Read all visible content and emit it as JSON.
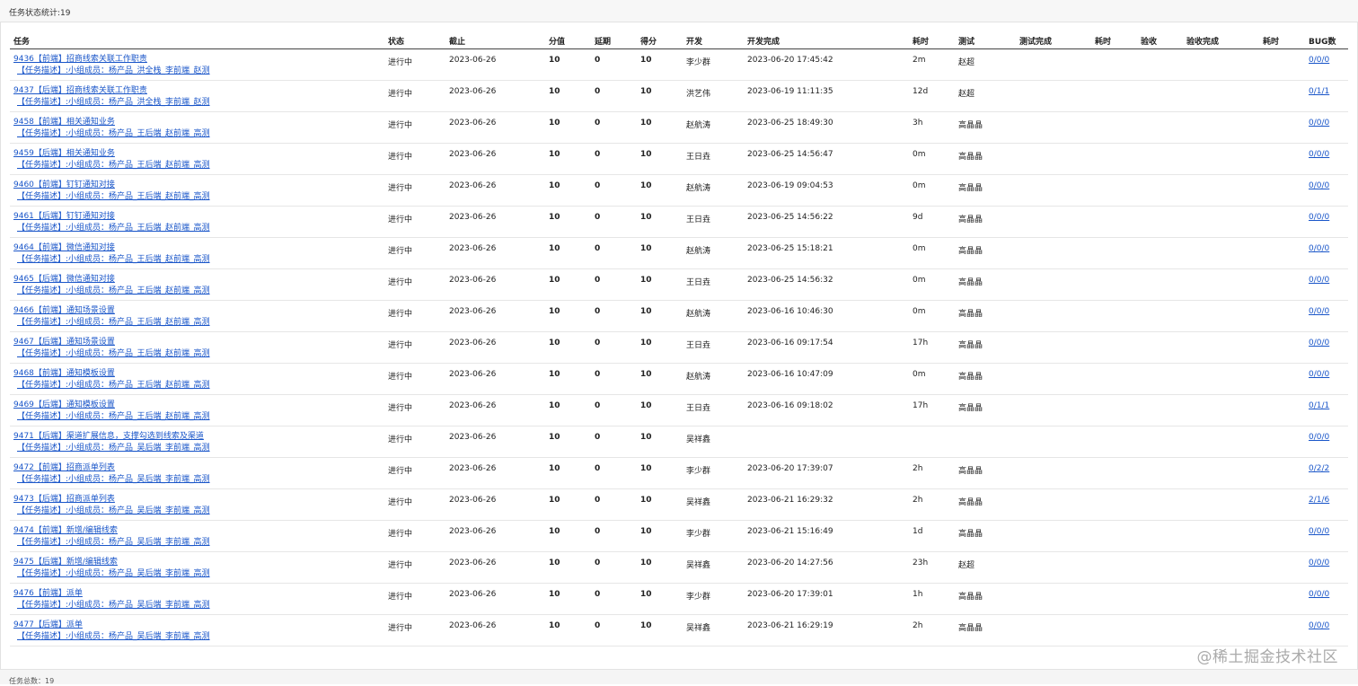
{
  "header": {
    "title": "任务状态统计:19"
  },
  "columns": [
    "任务",
    "状态",
    "截止",
    "分值",
    "延期",
    "得分",
    "开发",
    "开发完成",
    "耗时",
    "测试",
    "测试完成",
    "耗时",
    "验收",
    "验收完成",
    "耗时",
    "BUG数"
  ],
  "rows": [
    {
      "title": "9436【前端】招商线索关联工作职责",
      "desc": "【任务描述】:小组成员：杨产品_洪全栈_李前端_赵测",
      "status": "进行中",
      "deadline": "2023-06-26",
      "points": "10",
      "delay": "0",
      "score": "10",
      "dev": "李少群",
      "dev_done": "2023-06-20 17:45:42",
      "dev_time": "2m",
      "tester": "赵超",
      "test_done": "",
      "test_time": "",
      "acceptor": "",
      "accept_done": "",
      "accept_time": "",
      "bugs": "0/0/0"
    },
    {
      "title": "9437【后端】招商线索关联工作职责",
      "desc": "【任务描述】:小组成员：杨产品_洪全栈_李前端_赵测",
      "status": "进行中",
      "deadline": "2023-06-26",
      "points": "10",
      "delay": "0",
      "score": "10",
      "dev": "洪艺伟",
      "dev_done": "2023-06-19 11:11:35",
      "dev_time": "12d",
      "tester": "赵超",
      "test_done": "",
      "test_time": "",
      "acceptor": "",
      "accept_done": "",
      "accept_time": "",
      "bugs": "0/1/1"
    },
    {
      "title": "9458【前端】相关通知业务",
      "desc": "【任务描述】:小组成员：杨产品_王后端_赵前端_高测",
      "status": "进行中",
      "deadline": "2023-06-26",
      "points": "10",
      "delay": "0",
      "score": "10",
      "dev": "赵航涛",
      "dev_done": "2023-06-25 18:49:30",
      "dev_time": "3h",
      "tester": "高晶晶",
      "test_done": "",
      "test_time": "",
      "acceptor": "",
      "accept_done": "",
      "accept_time": "",
      "bugs": "0/0/0"
    },
    {
      "title": "9459【后端】相关通知业务",
      "desc": "【任务描述】:小组成员：杨产品_王后端_赵前端_高测",
      "status": "进行中",
      "deadline": "2023-06-26",
      "points": "10",
      "delay": "0",
      "score": "10",
      "dev": "王日垚",
      "dev_done": "2023-06-25 14:56:47",
      "dev_time": "0m",
      "tester": "高晶晶",
      "test_done": "",
      "test_time": "",
      "acceptor": "",
      "accept_done": "",
      "accept_time": "",
      "bugs": "0/0/0"
    },
    {
      "title": "9460【前端】钉钉通知对接",
      "desc": "【任务描述】:小组成员：杨产品_王后端_赵前端_高测",
      "status": "进行中",
      "deadline": "2023-06-26",
      "points": "10",
      "delay": "0",
      "score": "10",
      "dev": "赵航涛",
      "dev_done": "2023-06-19 09:04:53",
      "dev_time": "0m",
      "tester": "高晶晶",
      "test_done": "",
      "test_time": "",
      "acceptor": "",
      "accept_done": "",
      "accept_time": "",
      "bugs": "0/0/0"
    },
    {
      "title": "9461【后端】钉钉通知对接",
      "desc": "【任务描述】:小组成员：杨产品_王后端_赵前端_高测",
      "status": "进行中",
      "deadline": "2023-06-26",
      "points": "10",
      "delay": "0",
      "score": "10",
      "dev": "王日垚",
      "dev_done": "2023-06-25 14:56:22",
      "dev_time": "9d",
      "tester": "高晶晶",
      "test_done": "",
      "test_time": "",
      "acceptor": "",
      "accept_done": "",
      "accept_time": "",
      "bugs": "0/0/0"
    },
    {
      "title": "9464【前端】微信通知对接",
      "desc": "【任务描述】:小组成员：杨产品_王后端_赵前端_高测",
      "status": "进行中",
      "deadline": "2023-06-26",
      "points": "10",
      "delay": "0",
      "score": "10",
      "dev": "赵航涛",
      "dev_done": "2023-06-25 15:18:21",
      "dev_time": "0m",
      "tester": "高晶晶",
      "test_done": "",
      "test_time": "",
      "acceptor": "",
      "accept_done": "",
      "accept_time": "",
      "bugs": "0/0/0"
    },
    {
      "title": "9465【后端】微信通知对接",
      "desc": "【任务描述】:小组成员：杨产品_王后端_赵前端_高测",
      "status": "进行中",
      "deadline": "2023-06-26",
      "points": "10",
      "delay": "0",
      "score": "10",
      "dev": "王日垚",
      "dev_done": "2023-06-25 14:56:32",
      "dev_time": "0m",
      "tester": "高晶晶",
      "test_done": "",
      "test_time": "",
      "acceptor": "",
      "accept_done": "",
      "accept_time": "",
      "bugs": "0/0/0"
    },
    {
      "title": "9466【前端】通知场景设置",
      "desc": "【任务描述】:小组成员：杨产品_王后端_赵前端_高测",
      "status": "进行中",
      "deadline": "2023-06-26",
      "points": "10",
      "delay": "0",
      "score": "10",
      "dev": "赵航涛",
      "dev_done": "2023-06-16 10:46:30",
      "dev_time": "0m",
      "tester": "高晶晶",
      "test_done": "",
      "test_time": "",
      "acceptor": "",
      "accept_done": "",
      "accept_time": "",
      "bugs": "0/0/0"
    },
    {
      "title": "9467【后端】通知场景设置",
      "desc": "【任务描述】:小组成员：杨产品_王后端_赵前端_高测",
      "status": "进行中",
      "deadline": "2023-06-26",
      "points": "10",
      "delay": "0",
      "score": "10",
      "dev": "王日垚",
      "dev_done": "2023-06-16 09:17:54",
      "dev_time": "17h",
      "tester": "高晶晶",
      "test_done": "",
      "test_time": "",
      "acceptor": "",
      "accept_done": "",
      "accept_time": "",
      "bugs": "0/0/0"
    },
    {
      "title": "9468【前端】通知模板设置",
      "desc": "【任务描述】:小组成员：杨产品_王后端_赵前端_高测",
      "status": "进行中",
      "deadline": "2023-06-26",
      "points": "10",
      "delay": "0",
      "score": "10",
      "dev": "赵航涛",
      "dev_done": "2023-06-16 10:47:09",
      "dev_time": "0m",
      "tester": "高晶晶",
      "test_done": "",
      "test_time": "",
      "acceptor": "",
      "accept_done": "",
      "accept_time": "",
      "bugs": "0/0/0"
    },
    {
      "title": "9469【后端】通知模板设置",
      "desc": "【任务描述】:小组成员：杨产品_王后端_赵前端_高测",
      "status": "进行中",
      "deadline": "2023-06-26",
      "points": "10",
      "delay": "0",
      "score": "10",
      "dev": "王日垚",
      "dev_done": "2023-06-16 09:18:02",
      "dev_time": "17h",
      "tester": "高晶晶",
      "test_done": "",
      "test_time": "",
      "acceptor": "",
      "accept_done": "",
      "accept_time": "",
      "bugs": "0/1/1"
    },
    {
      "title": "9471【后端】渠道扩展信息，支撑勾选到线索及渠道",
      "desc": "【任务描述】:小组成员：杨产品_吴后端_李前端_高测",
      "status": "进行中",
      "deadline": "2023-06-26",
      "points": "10",
      "delay": "0",
      "score": "10",
      "dev": "吴祥鑫",
      "dev_done": "",
      "dev_time": "",
      "tester": "",
      "test_done": "",
      "test_time": "",
      "acceptor": "",
      "accept_done": "",
      "accept_time": "",
      "bugs": "0/0/0"
    },
    {
      "title": "9472【前端】招商派单列表",
      "desc": "【任务描述】:小组成员：杨产品_吴后端_李前端_高测",
      "status": "进行中",
      "deadline": "2023-06-26",
      "points": "10",
      "delay": "0",
      "score": "10",
      "dev": "李少群",
      "dev_done": "2023-06-20 17:39:07",
      "dev_time": "2h",
      "tester": "高晶晶",
      "test_done": "",
      "test_time": "",
      "acceptor": "",
      "accept_done": "",
      "accept_time": "",
      "bugs": "0/2/2"
    },
    {
      "title": "9473【后端】招商派单列表",
      "desc": "【任务描述】:小组成员：杨产品_吴后端_李前端_高测",
      "status": "进行中",
      "deadline": "2023-06-26",
      "points": "10",
      "delay": "0",
      "score": "10",
      "dev": "吴祥鑫",
      "dev_done": "2023-06-21 16:29:32",
      "dev_time": "2h",
      "tester": "高晶晶",
      "test_done": "",
      "test_time": "",
      "acceptor": "",
      "accept_done": "",
      "accept_time": "",
      "bugs": "2/1/6"
    },
    {
      "title": "9474【前端】新增/编辑线索",
      "desc": "【任务描述】:小组成员：杨产品_吴后端_李前端_高测",
      "status": "进行中",
      "deadline": "2023-06-26",
      "points": "10",
      "delay": "0",
      "score": "10",
      "dev": "李少群",
      "dev_done": "2023-06-21 15:16:49",
      "dev_time": "1d",
      "tester": "高晶晶",
      "test_done": "",
      "test_time": "",
      "acceptor": "",
      "accept_done": "",
      "accept_time": "",
      "bugs": "0/0/0"
    },
    {
      "title": "9475【后端】新增/编辑线索",
      "desc": "【任务描述】:小组成员：杨产品_吴后端_李前端_高测",
      "status": "进行中",
      "deadline": "2023-06-26",
      "points": "10",
      "delay": "0",
      "score": "10",
      "dev": "吴祥鑫",
      "dev_done": "2023-06-20 14:27:56",
      "dev_time": "23h",
      "tester": "赵超",
      "test_done": "",
      "test_time": "",
      "acceptor": "",
      "accept_done": "",
      "accept_time": "",
      "bugs": "0/0/0"
    },
    {
      "title": "9476【前端】派单",
      "desc": "【任务描述】:小组成员：杨产品_吴后端_李前端_高测",
      "status": "进行中",
      "deadline": "2023-06-26",
      "points": "10",
      "delay": "0",
      "score": "10",
      "dev": "李少群",
      "dev_done": "2023-06-20 17:39:01",
      "dev_time": "1h",
      "tester": "高晶晶",
      "test_done": "",
      "test_time": "",
      "acceptor": "",
      "accept_done": "",
      "accept_time": "",
      "bugs": "0/0/0"
    },
    {
      "title": "9477【后端】派单",
      "desc": "【任务描述】:小组成员：杨产品_吴后端_李前端_高测",
      "status": "进行中",
      "deadline": "2023-06-26",
      "points": "10",
      "delay": "0",
      "score": "10",
      "dev": "吴祥鑫",
      "dev_done": "2023-06-21 16:29:19",
      "dev_time": "2h",
      "tester": "高晶晶",
      "test_done": "",
      "test_time": "",
      "acceptor": "",
      "accept_done": "",
      "accept_time": "",
      "bugs": "0/0/0"
    }
  ],
  "footer": {
    "total": "任务总数：19"
  },
  "watermark": "@稀土掘金技术社区",
  "colors": {
    "link": "#1a56c9",
    "header_bg": "#f7f7f7",
    "border": "#e6e6e6"
  }
}
